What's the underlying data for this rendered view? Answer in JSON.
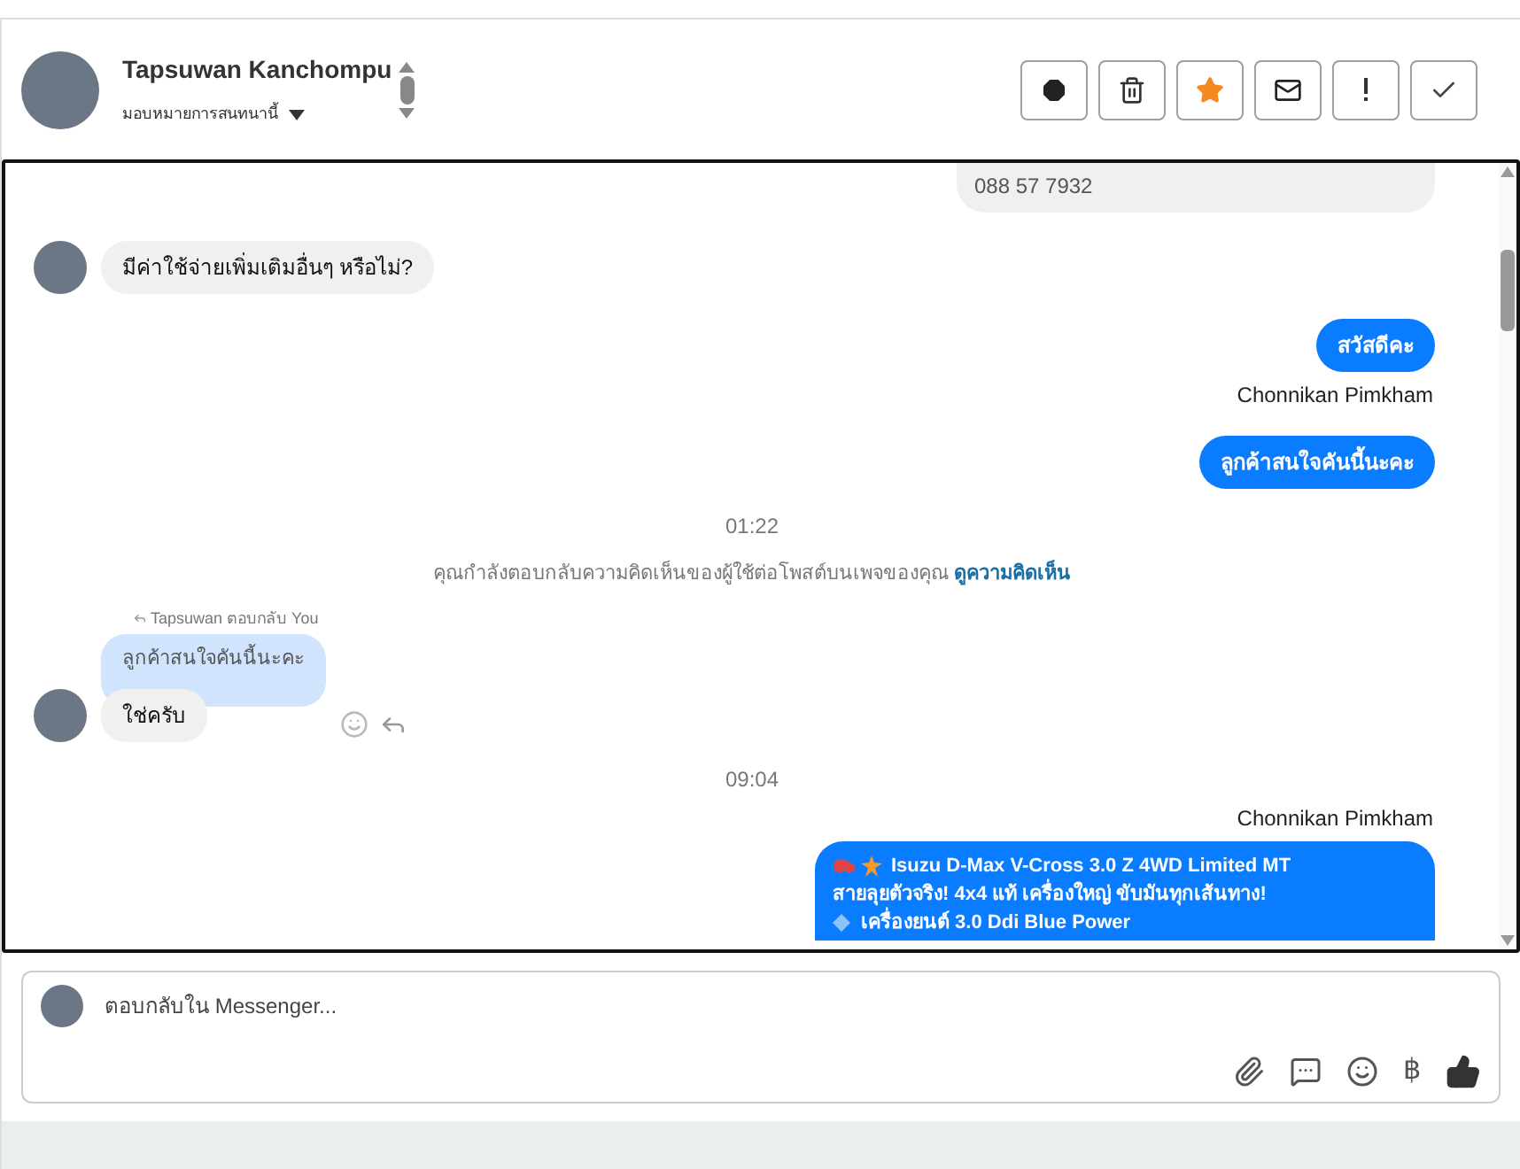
{
  "header": {
    "name": "Tapsuwan Kanchompu",
    "assign_label": "มอบหมายการสนทนานี้",
    "actions": [
      {
        "kind": "spam"
      },
      {
        "kind": "delete"
      },
      {
        "kind": "star",
        "on": true
      },
      {
        "kind": "unread"
      },
      {
        "kind": "important"
      },
      {
        "kind": "done"
      }
    ]
  },
  "messages": [
    {
      "kind": "partial",
      "text": "088 57 7932"
    },
    {
      "kind": "incoming",
      "text": "มีค่าใช้จ่ายเพิ่มเติมอื่นๆ หรือไม่?"
    },
    {
      "kind": "outgoing",
      "text": "สวัสดีคะ"
    },
    {
      "kind": "sender",
      "text": "Chonnikan Pimkham"
    },
    {
      "kind": "outgoing",
      "text": "ลูกค้าสนใจคันนี้นะคะ"
    },
    {
      "kind": "time",
      "text": "01:22"
    },
    {
      "kind": "notice",
      "text": "คุณกำลังตอบกลับความคิดเห็นของผู้ใช้ต่อโพสต์บนเพจของคุณ",
      "link": "ดูความคิดเห็น"
    },
    {
      "kind": "reply",
      "label": "Tapsuwan ตอบกลับ You",
      "quote": "ลูกค้าสนใจคันนี้นะคะ",
      "text": "ใช่ครับ"
    },
    {
      "kind": "time",
      "text": "09:04"
    },
    {
      "kind": "sender",
      "text": "Chonnikan Pimkham"
    },
    {
      "kind": "post",
      "lines": [
        {
          "kind": "title",
          "text": "Isuzu D-Max V-Cross 3.0 Z 4WD Limited MT"
        },
        {
          "kind": "plain",
          "text": "สายลุยตัวจริง! 4x4 แท้ เครื่องใหญ่ ขับมันทุกเส้นทาง!"
        },
        {
          "kind": "bullet",
          "text": "เครื่องยนต์ 3.0 Ddi Blue Power"
        }
      ]
    }
  ],
  "composer": {
    "placeholder": "ตอบกลับใน Messenger...",
    "tools": [
      {
        "kind": "attach"
      },
      {
        "kind": "reply"
      },
      {
        "kind": "emoji"
      },
      {
        "kind": "currency",
        "glyph": "฿"
      },
      {
        "kind": "like"
      }
    ]
  }
}
